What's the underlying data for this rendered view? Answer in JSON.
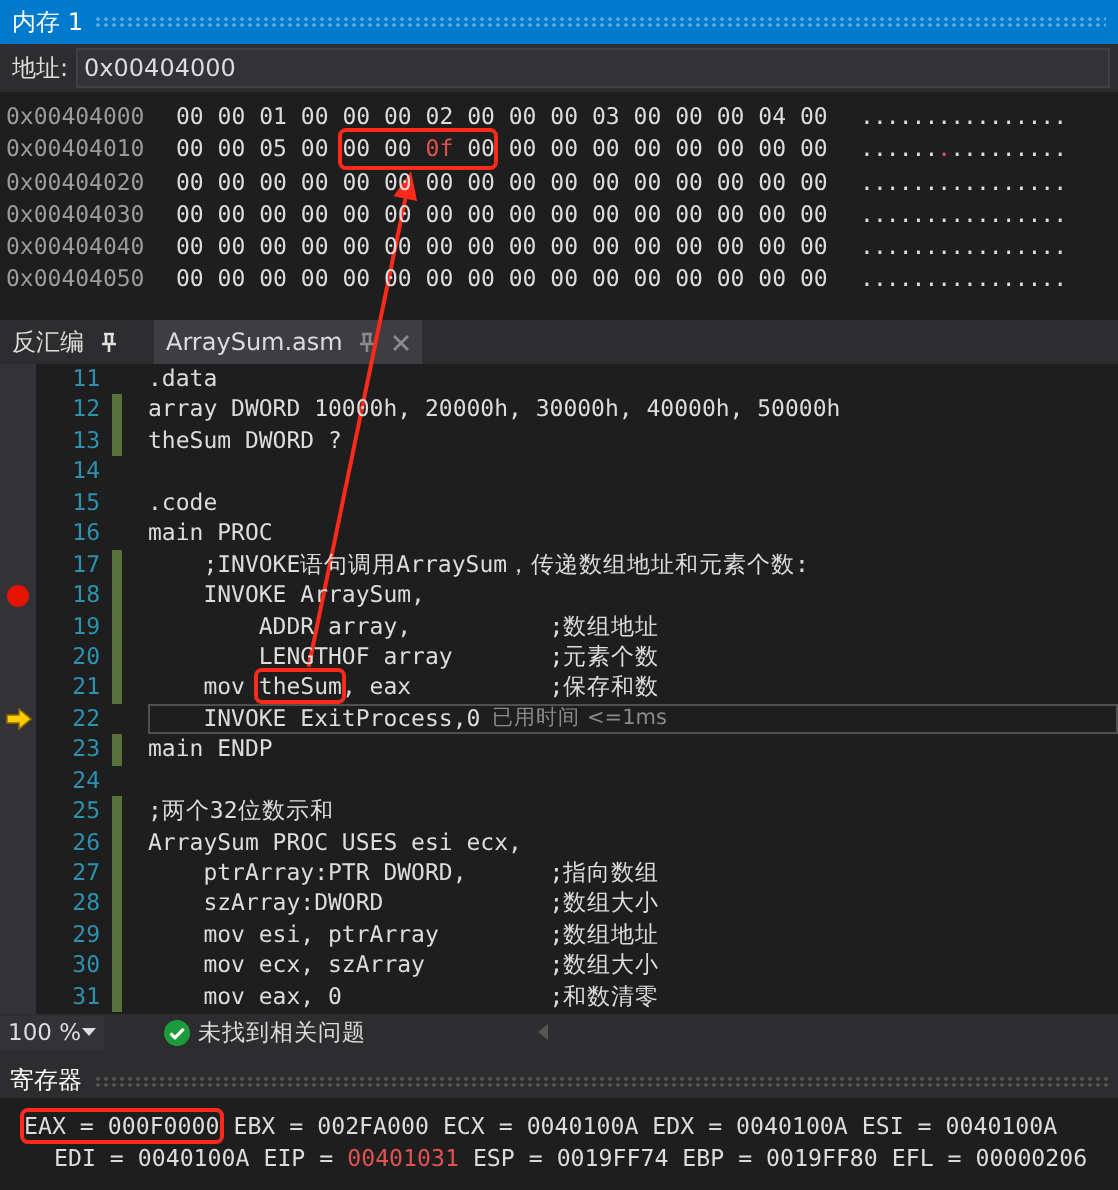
{
  "memory_window": {
    "title": "内存 1",
    "address_label": "地址:",
    "address": "0x00404000",
    "rows": [
      {
        "address": "0x00404000",
        "ascii": "................",
        "groups": [
          {
            "boxed": false,
            "bytes": [
              {
                "value": "00",
                "changed": false
              },
              {
                "value": "00",
                "changed": false
              },
              {
                "value": "01",
                "changed": false
              },
              {
                "value": "00",
                "changed": false
              },
              {
                "value": "00",
                "changed": false
              },
              {
                "value": "00",
                "changed": false
              },
              {
                "value": "02",
                "changed": false
              },
              {
                "value": "00",
                "changed": false
              },
              {
                "value": "00",
                "changed": false
              },
              {
                "value": "00",
                "changed": false
              },
              {
                "value": "03",
                "changed": false
              },
              {
                "value": "00",
                "changed": false
              },
              {
                "value": "00",
                "changed": false
              },
              {
                "value": "00",
                "changed": false
              },
              {
                "value": "04",
                "changed": false
              },
              {
                "value": "00",
                "changed": false
              }
            ]
          }
        ]
      },
      {
        "address": "0x00404010",
        "ascii": "................",
        "groups": [
          {
            "boxed": false,
            "bytes": [
              {
                "value": "00",
                "changed": false
              },
              {
                "value": "00",
                "changed": false
              },
              {
                "value": "05",
                "changed": false
              },
              {
                "value": "00",
                "changed": false
              }
            ]
          },
          {
            "boxed": true,
            "bytes": [
              {
                "value": "00",
                "changed": false
              },
              {
                "value": "00",
                "changed": false
              },
              {
                "value": "0f",
                "changed": true
              },
              {
                "value": "00",
                "changed": false
              }
            ]
          },
          {
            "boxed": false,
            "bytes": [
              {
                "value": "00",
                "changed": false
              },
              {
                "value": "00",
                "changed": false
              },
              {
                "value": "00",
                "changed": false
              },
              {
                "value": "00",
                "changed": false
              },
              {
                "value": "00",
                "changed": false
              },
              {
                "value": "00",
                "changed": false
              },
              {
                "value": "00",
                "changed": false
              },
              {
                "value": "00",
                "changed": false
              }
            ]
          }
        ]
      },
      {
        "address": "0x00404020",
        "ascii": "................",
        "groups": [
          {
            "boxed": false,
            "bytes": [
              {
                "value": "00",
                "changed": false
              },
              {
                "value": "00",
                "changed": false
              },
              {
                "value": "00",
                "changed": false
              },
              {
                "value": "00",
                "changed": false
              },
              {
                "value": "00",
                "changed": false
              },
              {
                "value": "00",
                "changed": false
              },
              {
                "value": "00",
                "changed": false
              },
              {
                "value": "00",
                "changed": false
              },
              {
                "value": "00",
                "changed": false
              },
              {
                "value": "00",
                "changed": false
              },
              {
                "value": "00",
                "changed": false
              },
              {
                "value": "00",
                "changed": false
              },
              {
                "value": "00",
                "changed": false
              },
              {
                "value": "00",
                "changed": false
              },
              {
                "value": "00",
                "changed": false
              },
              {
                "value": "00",
                "changed": false
              }
            ]
          }
        ]
      },
      {
        "address": "0x00404030",
        "ascii": "................",
        "groups": [
          {
            "boxed": false,
            "bytes": [
              {
                "value": "00",
                "changed": false
              },
              {
                "value": "00",
                "changed": false
              },
              {
                "value": "00",
                "changed": false
              },
              {
                "value": "00",
                "changed": false
              },
              {
                "value": "00",
                "changed": false
              },
              {
                "value": "00",
                "changed": false
              },
              {
                "value": "00",
                "changed": false
              },
              {
                "value": "00",
                "changed": false
              },
              {
                "value": "00",
                "changed": false
              },
              {
                "value": "00",
                "changed": false
              },
              {
                "value": "00",
                "changed": false
              },
              {
                "value": "00",
                "changed": false
              },
              {
                "value": "00",
                "changed": false
              },
              {
                "value": "00",
                "changed": false
              },
              {
                "value": "00",
                "changed": false
              },
              {
                "value": "00",
                "changed": false
              }
            ]
          }
        ]
      },
      {
        "address": "0x00404040",
        "ascii": "................",
        "groups": [
          {
            "boxed": false,
            "bytes": [
              {
                "value": "00",
                "changed": false
              },
              {
                "value": "00",
                "changed": false
              },
              {
                "value": "00",
                "changed": false
              },
              {
                "value": "00",
                "changed": false
              },
              {
                "value": "00",
                "changed": false
              },
              {
                "value": "00",
                "changed": false
              },
              {
                "value": "00",
                "changed": false
              },
              {
                "value": "00",
                "changed": false
              },
              {
                "value": "00",
                "changed": false
              },
              {
                "value": "00",
                "changed": false
              },
              {
                "value": "00",
                "changed": false
              },
              {
                "value": "00",
                "changed": false
              },
              {
                "value": "00",
                "changed": false
              },
              {
                "value": "00",
                "changed": false
              },
              {
                "value": "00",
                "changed": false
              },
              {
                "value": "00",
                "changed": false
              }
            ]
          }
        ]
      },
      {
        "address": "0x00404050",
        "ascii": "................",
        "groups": [
          {
            "boxed": false,
            "bytes": [
              {
                "value": "00",
                "changed": false
              },
              {
                "value": "00",
                "changed": false
              },
              {
                "value": "00",
                "changed": false
              },
              {
                "value": "00",
                "changed": false
              },
              {
                "value": "00",
                "changed": false
              },
              {
                "value": "00",
                "changed": false
              },
              {
                "value": "00",
                "changed": false
              },
              {
                "value": "00",
                "changed": false
              },
              {
                "value": "00",
                "changed": false
              },
              {
                "value": "00",
                "changed": false
              },
              {
                "value": "00",
                "changed": false
              },
              {
                "value": "00",
                "changed": false
              },
              {
                "value": "00",
                "changed": false
              },
              {
                "value": "00",
                "changed": false
              },
              {
                "value": "00",
                "changed": false
              },
              {
                "value": "00",
                "changed": false
              }
            ]
          }
        ]
      }
    ]
  },
  "editor": {
    "tabs": [
      {
        "label": "反汇编",
        "selected": false
      },
      {
        "label": "ArraySum.asm",
        "selected": true
      }
    ],
    "lines": [
      {
        "number": "11",
        "parts": [
          {
            "text": ".data",
            "boxed": false
          }
        ],
        "changed": false,
        "breakpoint": false,
        "current": false
      },
      {
        "number": "12",
        "parts": [
          {
            "text": "array DWORD 10000h, 20000h, 30000h, 40000h, 50000h",
            "boxed": false
          }
        ],
        "changed": true,
        "breakpoint": false,
        "current": false
      },
      {
        "number": "13",
        "parts": [
          {
            "text": "theSum DWORD ?",
            "boxed": false
          }
        ],
        "changed": true,
        "breakpoint": false,
        "current": false
      },
      {
        "number": "14",
        "changed": false,
        "breakpoint": false,
        "current": false
      },
      {
        "number": "15",
        "parts": [
          {
            "text": ".code",
            "boxed": false
          }
        ],
        "changed": false,
        "breakpoint": false,
        "current": false
      },
      {
        "number": "16",
        "parts": [
          {
            "text": "main PROC",
            "boxed": false
          }
        ],
        "changed": false,
        "breakpoint": false,
        "current": false
      },
      {
        "number": "17",
        "parts": [
          {
            "text": "    ;INVOKE语句调用ArraySum，传递数组地址和元素个数:",
            "boxed": false
          }
        ],
        "changed": true,
        "breakpoint": false,
        "current": false
      },
      {
        "number": "18",
        "parts": [
          {
            "text": "    INVOKE ArraySum,",
            "boxed": false
          }
        ],
        "changed": true,
        "breakpoint": true,
        "current": false
      },
      {
        "number": "19",
        "parts": [
          {
            "text": "        ADDR array,",
            "boxed": false
          }
        ],
        "comment": ";数组地址",
        "changed": true,
        "breakpoint": false,
        "current": false
      },
      {
        "number": "20",
        "parts": [
          {
            "text": "        LENGTHOF array",
            "boxed": false
          }
        ],
        "comment": ";元素个数",
        "changed": true,
        "breakpoint": false,
        "current": false
      },
      {
        "number": "21",
        "parts": [
          {
            "text": "    mov ",
            "boxed": false
          },
          {
            "text": "theSum",
            "boxed": true
          },
          {
            "text": ", eax",
            "boxed": false
          }
        ],
        "comment": ";保存和数",
        "changed": true,
        "breakpoint": false,
        "current": false
      },
      {
        "number": "22",
        "parts": [
          {
            "text": "    INVOKE ExitProcess,0",
            "boxed": false
          }
        ],
        "hint": "已用时间 <=1ms",
        "changed": false,
        "breakpoint": false,
        "current": true
      },
      {
        "number": "23",
        "parts": [
          {
            "text": "main ENDP",
            "boxed": false
          }
        ],
        "changed": true,
        "breakpoint": false,
        "current": false
      },
      {
        "number": "24",
        "changed": false,
        "breakpoint": false,
        "current": false
      },
      {
        "number": "25",
        "parts": [
          {
            "text": ";两个32位数示和",
            "boxed": false
          }
        ],
        "changed": true,
        "breakpoint": false,
        "current": false
      },
      {
        "number": "26",
        "parts": [
          {
            "text": "ArraySum PROC USES esi ecx,",
            "boxed": false
          }
        ],
        "changed": true,
        "breakpoint": false,
        "current": false
      },
      {
        "number": "27",
        "parts": [
          {
            "text": "    ptrArray:PTR DWORD,",
            "boxed": false
          }
        ],
        "comment": ";指向数组",
        "changed": true,
        "breakpoint": false,
        "current": false
      },
      {
        "number": "28",
        "parts": [
          {
            "text": "    szArray:DWORD",
            "boxed": false
          }
        ],
        "comment": ";数组大小",
        "changed": true,
        "breakpoint": false,
        "current": false
      },
      {
        "number": "29",
        "parts": [
          {
            "text": "    mov esi, ptrArray",
            "boxed": false
          }
        ],
        "comment": ";数组地址",
        "changed": true,
        "breakpoint": false,
        "current": false
      },
      {
        "number": "30",
        "parts": [
          {
            "text": "    mov ecx, szArray",
            "boxed": false
          }
        ],
        "comment": ";数组大小",
        "changed": true,
        "breakpoint": false,
        "current": false
      },
      {
        "number": "31",
        "parts": [
          {
            "text": "    mov eax, 0",
            "boxed": false
          }
        ],
        "comment": ";和数清零",
        "changed": true,
        "breakpoint": false,
        "current": false
      }
    ],
    "zoom": "100 %",
    "issues": "未找到相关问题"
  },
  "registers": {
    "title": "寄存器",
    "rows": [
      {
        "items": [
          {
            "label": "EAX =",
            "value": "000F0000",
            "changed": false,
            "boxed": true
          },
          {
            "label": "EBX =",
            "value": "002FA000",
            "changed": false,
            "boxed": false
          },
          {
            "label": "ECX =",
            "value": "0040100A",
            "changed": false,
            "boxed": false
          },
          {
            "label": "EDX =",
            "value": "0040100A",
            "changed": false,
            "boxed": false
          },
          {
            "label": "ESI =",
            "value": "0040100A",
            "changed": false,
            "boxed": false
          }
        ]
      },
      {
        "items": [
          {
            "label": "EDI =",
            "value": "0040100A",
            "changed": false,
            "boxed": false
          },
          {
            "label": "EIP =",
            "value": "00401031",
            "changed": true,
            "boxed": false
          },
          {
            "label": "ESP =",
            "value": "0019FF74",
            "changed": false,
            "boxed": false
          },
          {
            "label": "EBP =",
            "value": "0019FF80",
            "changed": false,
            "boxed": false
          },
          {
            "label": "EFL =",
            "value": "00000206",
            "changed": false,
            "boxed": false
          }
        ]
      }
    ]
  }
}
